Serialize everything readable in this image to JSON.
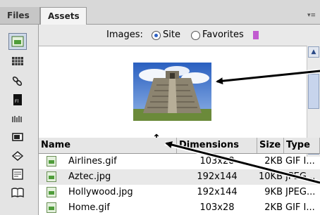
{
  "tabs": [
    {
      "label": "Files"
    },
    {
      "label": "Assets"
    }
  ],
  "options_menu": {
    "icon": "options-menu-icon"
  },
  "categories": [
    {
      "name": "images-icon",
      "selected": true
    },
    {
      "name": "colors-icon"
    },
    {
      "name": "urls-icon"
    },
    {
      "name": "flash-icon"
    },
    {
      "name": "shockwave-icon"
    },
    {
      "name": "movies-icon"
    },
    {
      "name": "scripts-icon"
    },
    {
      "name": "templates-icon"
    },
    {
      "name": "library-icon"
    }
  ],
  "filter": {
    "label": "Images:",
    "options": [
      {
        "label": "Site",
        "checked": true
      },
      {
        "label": "Favorites",
        "checked": false
      }
    ]
  },
  "list": {
    "columns": [
      "Name",
      "Dimensions",
      "Size",
      "Type"
    ],
    "rows": [
      {
        "name": "Airlines.gif",
        "dimensions": "103x28",
        "size": "2KB",
        "type": "GIF I..."
      },
      {
        "name": "Aztec.jpg",
        "dimensions": "192x144",
        "size": "10KB",
        "type": "JPEG...",
        "selected": true
      },
      {
        "name": "Hollywood.jpg",
        "dimensions": "192x144",
        "size": "9KB",
        "type": "JPEG..."
      },
      {
        "name": "Home.gif",
        "dimensions": "103x28",
        "size": "2KB",
        "type": "GIF I..."
      }
    ]
  },
  "colors": {
    "selection": "#e8e8e8",
    "tab_active": "#f4f4f4",
    "panel": "#d8d8d8"
  }
}
